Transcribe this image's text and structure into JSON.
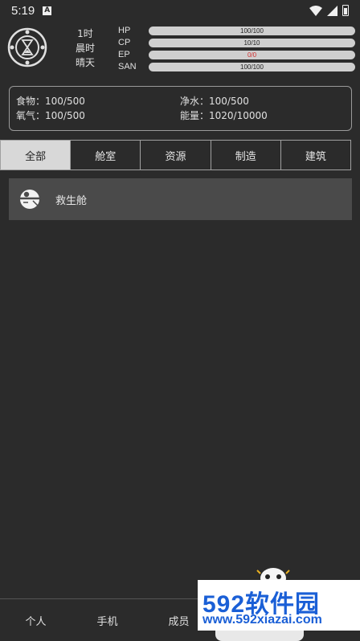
{
  "status_bar": {
    "time": "5:19",
    "notification_icon": "android-a-icon",
    "icons": [
      "wifi-icon",
      "signal-icon",
      "battery-icon"
    ]
  },
  "header": {
    "emblem_icon": "hourglass-emblem-icon",
    "day": "1时",
    "period": "晨时",
    "weather": "晴天",
    "stats": [
      {
        "label": "HP",
        "value": "100/100",
        "fill": 1.0,
        "color": "#cfcfcf"
      },
      {
        "label": "CP",
        "value": "10/10",
        "fill": 1.0,
        "color": "#cfcfcf"
      },
      {
        "label": "EP",
        "value": "0/0",
        "fill": 1.0,
        "color": "#d23030"
      },
      {
        "label": "SAN",
        "value": "100/100",
        "fill": 1.0,
        "color": "#cfcfcf"
      }
    ]
  },
  "resources": {
    "food": "食物：100/500",
    "water": "净水：100/500",
    "oxygen": "氧气：100/500",
    "energy": "能量：1020/10000"
  },
  "tabs": [
    "全部",
    "舱室",
    "资源",
    "制造",
    "建筑"
  ],
  "active_tab": "全部",
  "items": [
    {
      "label": "救生舱",
      "icon": "escape-pod-icon"
    }
  ],
  "bottom_nav": [
    "个人",
    "手机",
    "成员"
  ],
  "watermark": {
    "brand": "592软件园",
    "url": "www.592xiazai.com"
  },
  "colors": {
    "background": "#2b2b2b",
    "panel": "#4a4a4a",
    "bar": "#cfcfcf",
    "active_tab": "#d8d8d8",
    "watermark_blue": "#1a5fd6"
  }
}
